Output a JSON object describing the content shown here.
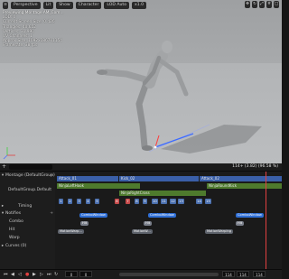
{
  "viewport": {
    "toolbar": {
      "perspective": "Perspective",
      "lit": "Lit",
      "show": "Show",
      "character": "Character",
      "lod": "LOD Auto",
      "speed": "x1.0"
    },
    "stats": [
      "Previewing Montage AM_Com...",
      "LOD: 0",
      "Current Screen Size: 0.426",
      "Triangles: 40,652",
      "Vertices: 31,990",
      "UV Channels: 1",
      "Approx Size: 1092x1867x1154",
      "Framerate: 38 fps"
    ]
  },
  "timeline": {
    "frame_readout": "114+ (3.82) (96.58 %)",
    "tracks": [
      {
        "label": "Montage (DefaultGroup)",
        "expandable": true
      },
      {
        "label": "DefaultGroup.Default",
        "expandable": false
      },
      {
        "label": "Timing",
        "expandable": true
      },
      {
        "label": "Notifies",
        "expandable": true
      },
      {
        "label": "Combo",
        "expandable": false
      },
      {
        "label": "Hit",
        "expandable": false
      },
      {
        "label": "Warp",
        "expandable": false
      },
      {
        "label": "Curves (0)",
        "expandable": true
      }
    ],
    "sections": [
      "Attack_01",
      "Kick_02",
      "Attack_02"
    ],
    "anims": [
      "NinjaLeftHook",
      "NinjaRightCross",
      "NinjaRoundKick"
    ],
    "timing_markers": [
      "1",
      "2",
      "3",
      "4",
      "5",
      "6",
      "7",
      "8",
      "9",
      "10",
      "11",
      "12",
      "13",
      "14",
      "15"
    ],
    "notifies": {
      "combo": [
        "ComboWindow",
        "ComboWindow",
        "ComboWindow"
      ],
      "hit": [
        "Hit",
        "Hit",
        "Hit"
      ],
      "warp": [
        "MotionWarp...",
        "MotionW...",
        "MotionWarping"
      ]
    },
    "controls": {
      "start_frame": "0",
      "end_frame": "114",
      "end_frame2": "114",
      "current_frame": "114"
    }
  }
}
